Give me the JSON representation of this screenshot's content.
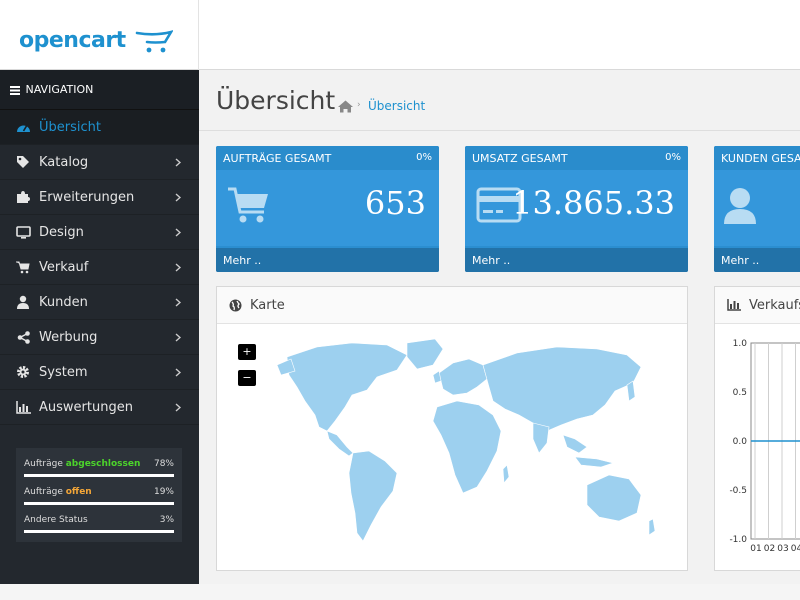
{
  "header": {
    "logo_text": "opencart"
  },
  "sidebar": {
    "nav_title": "NAVIGATION",
    "items": [
      {
        "label": "Übersicht",
        "icon": "dashboard-icon",
        "active": true
      },
      {
        "label": "Katalog",
        "icon": "tags-icon"
      },
      {
        "label": "Erweiterungen",
        "icon": "puzzle-icon"
      },
      {
        "label": "Design",
        "icon": "monitor-icon"
      },
      {
        "label": "Verkauf",
        "icon": "shopping-cart-icon"
      },
      {
        "label": "Kunden",
        "icon": "user-icon"
      },
      {
        "label": "Werbung",
        "icon": "share-icon"
      },
      {
        "label": "System",
        "icon": "cog-icon"
      },
      {
        "label": "Auswertungen",
        "icon": "bar-chart-icon"
      }
    ],
    "stats": [
      {
        "prefix": "Aufträge ",
        "highlight": "abgeschlossen",
        "suffix": "",
        "percent": "78%",
        "color": "#4cd42b",
        "level": 0.78
      },
      {
        "prefix": "Aufträge ",
        "highlight": "offen",
        "suffix": "",
        "percent": "19%",
        "color": "#f3a638",
        "level": 0.19
      },
      {
        "prefix": "Andere Status",
        "highlight": "",
        "suffix": "",
        "percent": "3%",
        "color": "#ffffff",
        "level": 0.03
      }
    ]
  },
  "page": {
    "title": "Übersicht",
    "breadcrumb": "Übersicht"
  },
  "tiles": [
    {
      "heading": "AUFTRÄGE GESAMT",
      "percent": "0%",
      "value": "653",
      "footer": "Mehr ..",
      "icon": "cart-icon"
    },
    {
      "heading": "UMSATZ GESAMT",
      "percent": "0%",
      "value": "13.865.33",
      "footer": "Mehr ..",
      "icon": "credit-card-icon"
    },
    {
      "heading": "KUNDEN GESAM",
      "percent": "",
      "value": "",
      "footer": "Mehr ..",
      "icon": "user-icon"
    }
  ],
  "map_panel": {
    "title": "Karte",
    "zoom_in": "+",
    "zoom_out": "−"
  },
  "sales_panel": {
    "title": "Verkaufs"
  },
  "chart_data": {
    "type": "line",
    "title": "",
    "xlabel": "",
    "ylabel": "",
    "ylim": [
      -1.0,
      1.0
    ],
    "yticks": [
      "1.0",
      "0.5",
      "0.0",
      "-0.5",
      "-1.0"
    ],
    "categories": [
      "01",
      "02",
      "03",
      "04"
    ],
    "series": [
      {
        "values": [
          0,
          0,
          0,
          0
        ]
      }
    ],
    "grid": true
  },
  "colors": {
    "accent": "#1e91cf",
    "tile": "#2b8ed0",
    "sidebar": "#23282e"
  }
}
